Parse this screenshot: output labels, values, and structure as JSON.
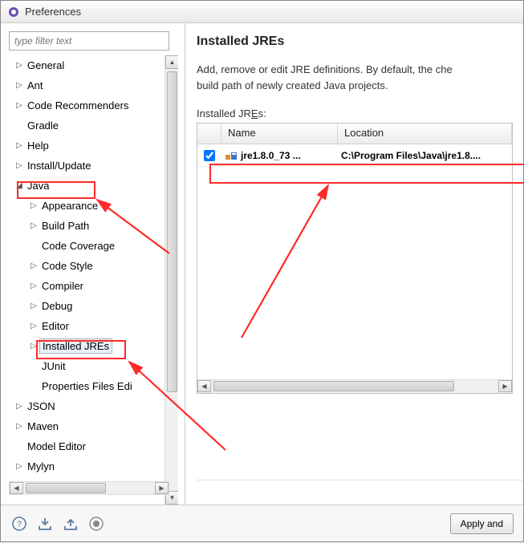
{
  "window": {
    "title": "Preferences"
  },
  "filter": {
    "placeholder": "type filter text"
  },
  "tree": {
    "items": [
      {
        "label": "General",
        "level": 0,
        "arrow": "▷"
      },
      {
        "label": "Ant",
        "level": 0,
        "arrow": "▷"
      },
      {
        "label": "Code Recommenders",
        "level": 0,
        "arrow": "▷"
      },
      {
        "label": "Gradle",
        "level": 0,
        "arrow": ""
      },
      {
        "label": "Help",
        "level": 0,
        "arrow": "▷"
      },
      {
        "label": "Install/Update",
        "level": 0,
        "arrow": "▷"
      },
      {
        "label": "Java",
        "level": 0,
        "arrow": "◢"
      },
      {
        "label": "Appearance",
        "level": 1,
        "arrow": "▷"
      },
      {
        "label": "Build Path",
        "level": 1,
        "arrow": "▷"
      },
      {
        "label": "Code Coverage",
        "level": 1,
        "arrow": ""
      },
      {
        "label": "Code Style",
        "level": 1,
        "arrow": "▷"
      },
      {
        "label": "Compiler",
        "level": 1,
        "arrow": "▷"
      },
      {
        "label": "Debug",
        "level": 1,
        "arrow": "▷"
      },
      {
        "label": "Editor",
        "level": 1,
        "arrow": "▷"
      },
      {
        "label": "Installed JREs",
        "level": 1,
        "arrow": "▷",
        "selected": true
      },
      {
        "label": "JUnit",
        "level": 1,
        "arrow": ""
      },
      {
        "label": "Properties Files Edi",
        "level": 1,
        "arrow": ""
      },
      {
        "label": "JSON",
        "level": 0,
        "arrow": "▷"
      },
      {
        "label": "Maven",
        "level": 0,
        "arrow": "▷"
      },
      {
        "label": "Model Editor",
        "level": 0,
        "arrow": ""
      },
      {
        "label": "Mylyn",
        "level": 0,
        "arrow": "▷"
      }
    ]
  },
  "main": {
    "title": "Installed JREs",
    "description_line1": "Add, remove or edit JRE definitions. By default, the che",
    "description_line2": "build path of newly created Java projects.",
    "table_caption_pre": "Installed JR",
    "table_caption_u": "E",
    "table_caption_post": "s:",
    "columns": {
      "name": "Name",
      "location": "Location"
    },
    "rows": [
      {
        "checked": true,
        "name": "jre1.8.0_73 ...",
        "location": "C:\\Program Files\\Java\\jre1.8...."
      }
    ]
  },
  "footer": {
    "apply_label": "Apply and"
  }
}
